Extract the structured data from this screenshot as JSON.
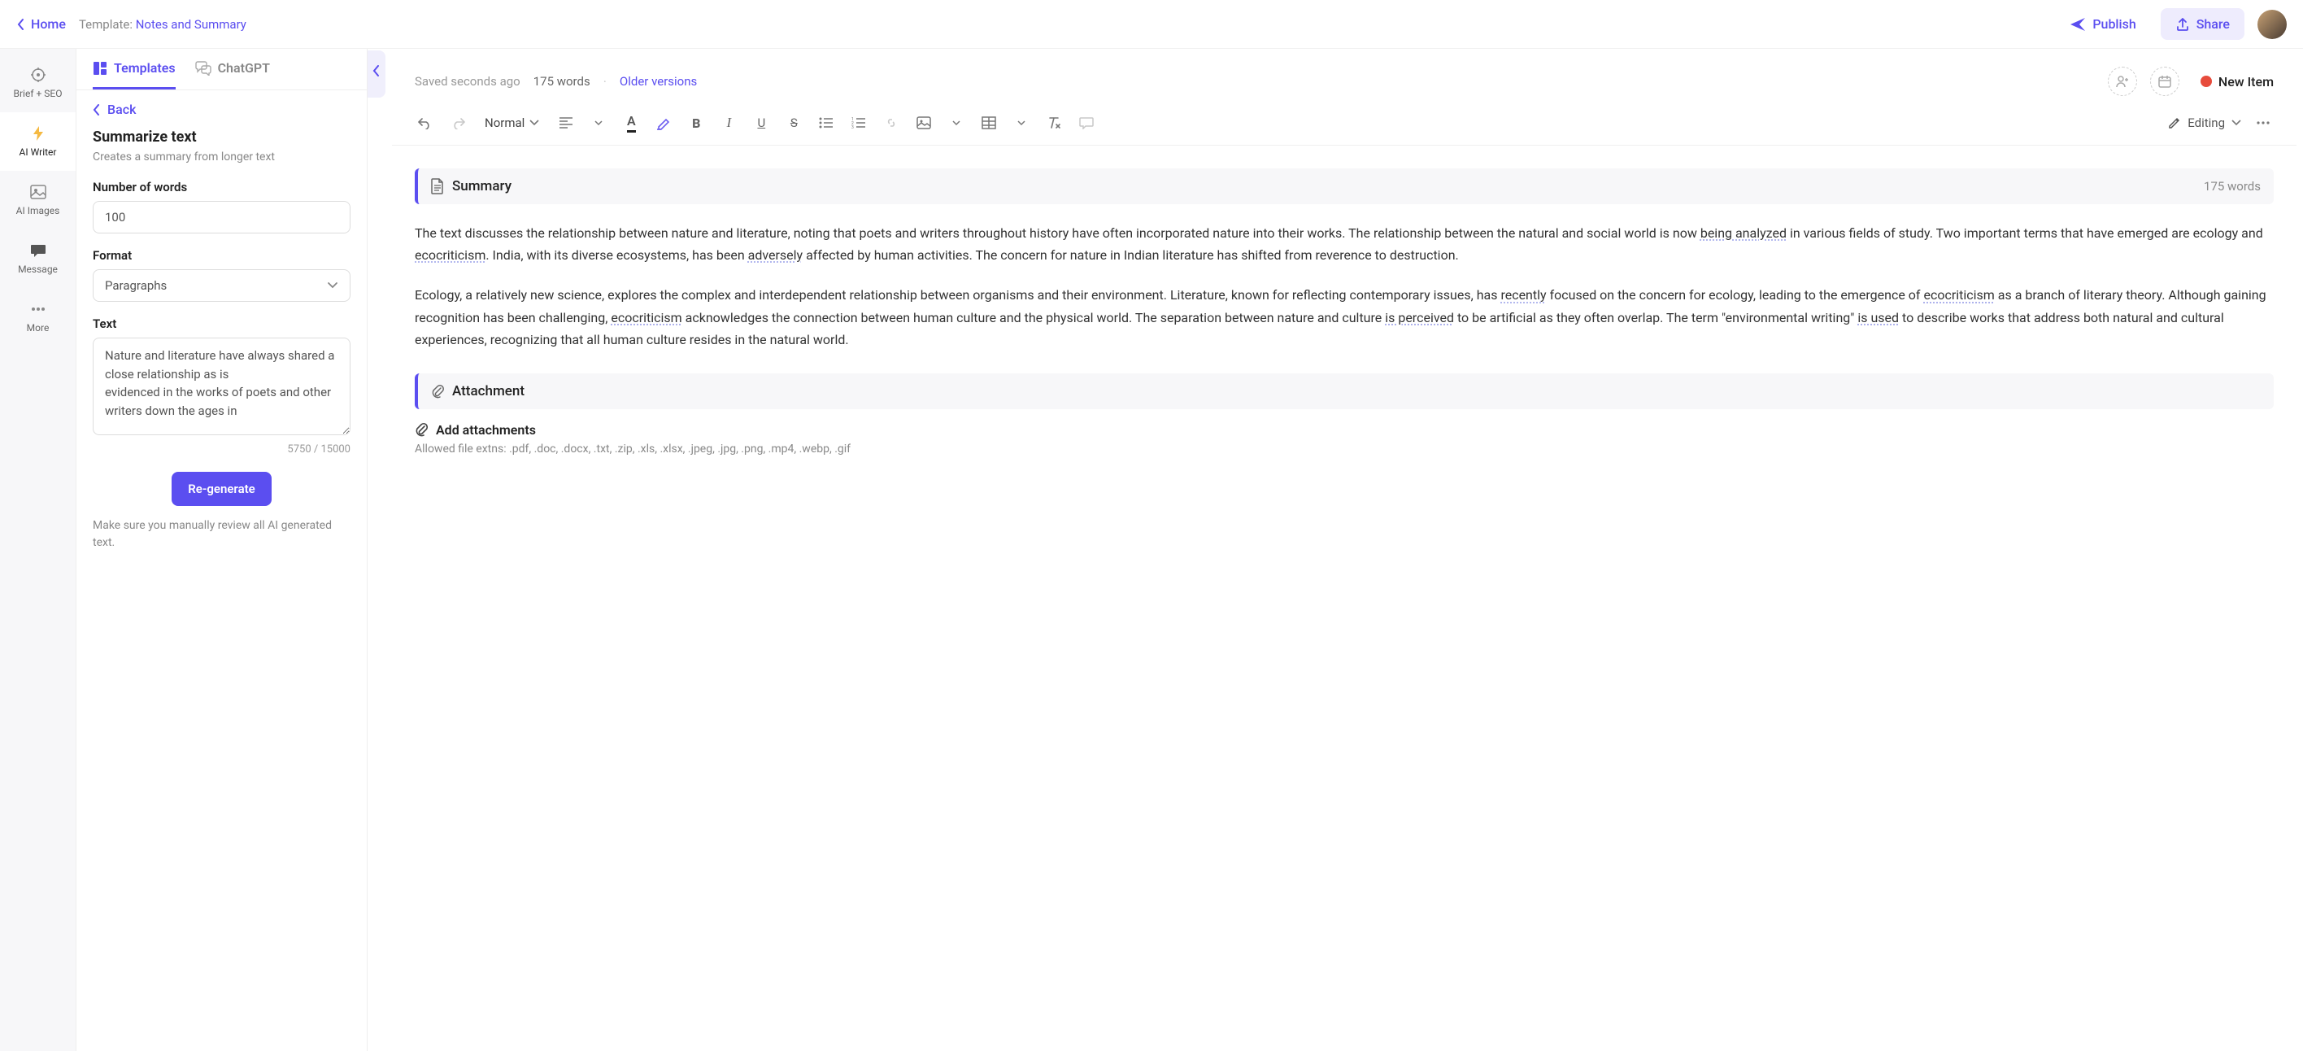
{
  "topbar": {
    "home": "Home",
    "template_prefix": "Template: ",
    "template_name": "Notes and Summary",
    "publish": "Publish",
    "share": "Share"
  },
  "rail": {
    "items": [
      {
        "label": "Brief + SEO"
      },
      {
        "label": "AI Writer"
      },
      {
        "label": "AI Images"
      },
      {
        "label": "Message"
      },
      {
        "label": "More"
      }
    ]
  },
  "tabs": {
    "templates": "Templates",
    "chatgpt": "ChatGPT"
  },
  "panel": {
    "back": "Back",
    "title": "Summarize text",
    "subtitle": "Creates a summary from longer text",
    "num_words_label": "Number of words",
    "num_words_value": "100",
    "format_label": "Format",
    "format_value": "Paragraphs",
    "text_label": "Text",
    "text_value": "Nature and literature have always shared a close relationship as is\nevidenced in the works of poets and other writers down the ages in",
    "char_count": "5750 / 15000",
    "regenerate": "Re-generate",
    "disclaimer": "Make sure you manually review all AI generated text."
  },
  "doc": {
    "saved": "Saved seconds ago",
    "word_count": "175 words",
    "older_versions": "Older versions",
    "new_item": "New Item"
  },
  "toolbar": {
    "style": "Normal",
    "editing": "Editing"
  },
  "content": {
    "summary_heading": "Summary",
    "summary_wc": "175 words",
    "p1a": "The text discusses the relationship between nature and literature, noting that poets and writers throughout history have often incorporated nature into their works. The relationship between the natural and social world is now ",
    "p1b": "being analyzed",
    "p1c": " in various fields of study. Two important terms that have emerged are ecology and ",
    "p1d": "ecocriticism",
    "p1e": ". India, with its diverse ecosystems, has been ",
    "p1f": "adversely",
    "p1g": " affected by human activities. The concern for nature in Indian literature has shifted from reverence to destruction.",
    "p2a": "Ecology, a relatively new science, explores the complex and interdependent relationship between organisms and their environment. Literature, known for reflecting contemporary issues, has ",
    "p2b": "recently",
    "p2c": " focused on the concern for ecology, leading to the emergence of ",
    "p2d": "ecocriticism",
    "p2e": " as a branch of literary theory. Although gaining recognition has been challenging, ",
    "p2f": "ecocriticism",
    "p2g": " acknowledges the connection between human culture and the physical world. The separation between nature and culture ",
    "p2h": "is perceived",
    "p2i": " to be artificial as they often overlap. The term \"environmental writing\" ",
    "p2j": "is used",
    "p2k": " to describe works that address both natural and cultural experiences, recognizing that all human culture resides in the natural world.",
    "attachment_heading": "Attachment",
    "add_attachments": "Add attachments",
    "allowed_extns": "Allowed file extns: .pdf, .doc, .docx, .txt, .zip, .xls, .xlsx, .jpeg, .jpg, .png, .mp4, .webp, .gif"
  }
}
